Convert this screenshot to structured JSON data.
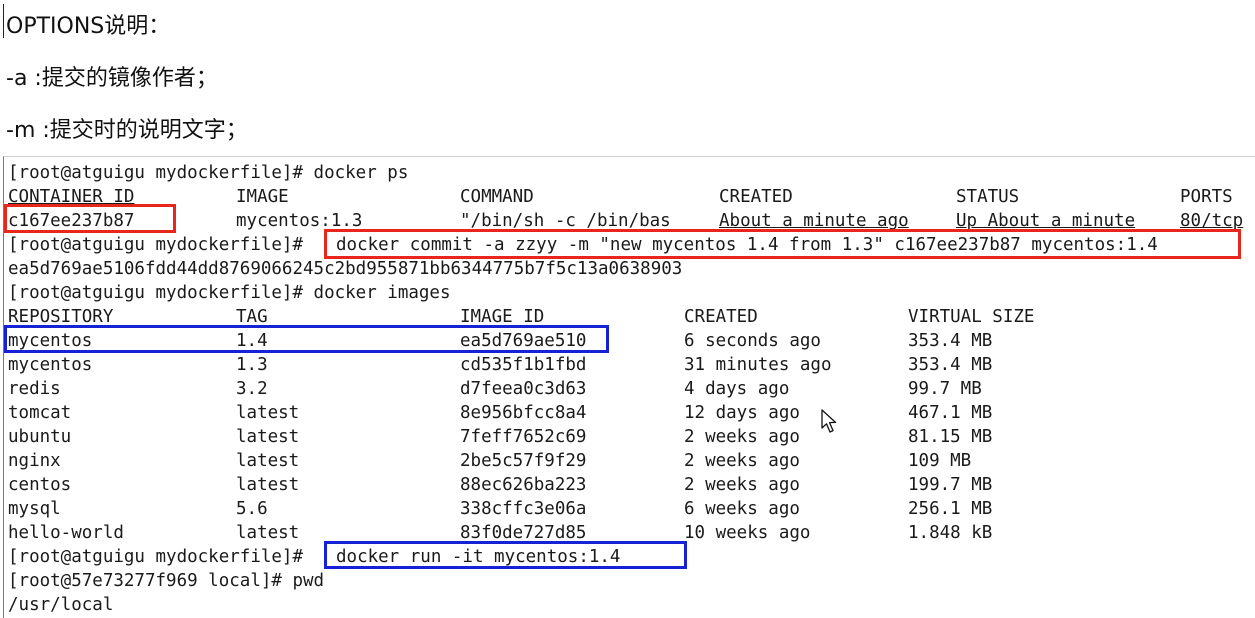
{
  "doc": {
    "options_heading": "OPTIONS说明：",
    "opt_a": "-a :提交的镜像作者；",
    "opt_m": "-m :提交时的说明文字；"
  },
  "terminal": {
    "cmd_ps": "[root@atguigu mydockerfile]# docker ps",
    "ps_headers": {
      "container_id": "CONTAINER ID",
      "image": "IMAGE",
      "command": "COMMAND",
      "created": "CREATED",
      "status": "STATUS",
      "ports": "PORTS"
    },
    "ps_row": {
      "container_id": "c167ee237b87",
      "image": "mycentos:1.3",
      "command": "\"/bin/sh -c /bin/bas",
      "created": "About a minute ago",
      "status": "Up About a minute",
      "ports": "80/tcp"
    },
    "commit_prompt": "[root@atguigu mydockerfile]#",
    "commit_cmd": "docker commit -a zzyy -m \"new mycentos 1.4 from 1.3\" c167ee237b87 mycentos:1.4",
    "commit_hash": "ea5d769ae5106fdd44dd8769066245c2bd955871bb6344775b7f5c13a0638903",
    "cmd_images": "[root@atguigu mydockerfile]# docker images",
    "img_headers": {
      "repository": "REPOSITORY",
      "tag": "TAG",
      "image_id": "IMAGE ID",
      "created": "CREATED",
      "size": "VIRTUAL SIZE"
    },
    "images": [
      {
        "repository": "mycentos",
        "tag": "1.4",
        "image_id": "ea5d769ae510",
        "created": "6 seconds ago",
        "size": "353.4 MB"
      },
      {
        "repository": "mycentos",
        "tag": "1.3",
        "image_id": "cd535f1b1fbd",
        "created": "31 minutes ago",
        "size": "353.4 MB"
      },
      {
        "repository": "redis",
        "tag": "3.2",
        "image_id": "d7feea0c3d63",
        "created": "4 days ago",
        "size": "99.7 MB"
      },
      {
        "repository": "tomcat",
        "tag": "latest",
        "image_id": "8e956bfcc8a4",
        "created": "12 days ago",
        "size": "467.1 MB"
      },
      {
        "repository": "ubuntu",
        "tag": "latest",
        "image_id": "7feff7652c69",
        "created": "2 weeks ago",
        "size": "81.15 MB"
      },
      {
        "repository": "nginx",
        "tag": "latest",
        "image_id": "2be5c57f9f29",
        "created": "2 weeks ago",
        "size": "109 MB"
      },
      {
        "repository": "centos",
        "tag": "latest",
        "image_id": "88ec626ba223",
        "created": "2 weeks ago",
        "size": "199.7 MB"
      },
      {
        "repository": "mysql",
        "tag": "5.6",
        "image_id": "338cffc3e06a",
        "created": "6 weeks ago",
        "size": "256.1 MB"
      },
      {
        "repository": "hello-world",
        "tag": "latest",
        "image_id": "83f0de727d85",
        "created": "10 weeks ago",
        "size": "1.848 kB"
      }
    ],
    "run_prompt": "[root@atguigu mydockerfile]#",
    "run_cmd": "docker run -it mycentos:1.4",
    "pwd_line": "[root@57e73277f969 local]# pwd",
    "pwd_output": "/usr/local"
  },
  "colors": {
    "highlight_red": "#e8261c",
    "highlight_blue": "#1522d6"
  },
  "icons": {
    "mouse": "mouse-pointer-icon"
  }
}
